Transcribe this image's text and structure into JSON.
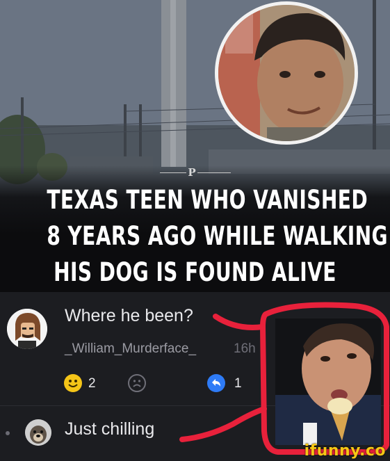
{
  "headline": {
    "logo": "P",
    "lines": [
      "TEXAS TEEN WHO VANISHED",
      "8 YEARS AGO WHILE WALKING",
      "HIS DOG IS FOUND ALIVE"
    ]
  },
  "comments": [
    {
      "text": "Where he been?",
      "username": "_William_Murderface_",
      "time": "16h",
      "reactions": [
        {
          "icon": "smile-icon",
          "count": "2"
        },
        {
          "icon": "frown-icon",
          "count": ""
        },
        {
          "icon": "reply-icon",
          "count": "1"
        }
      ]
    },
    {
      "text": "Just chilling"
    }
  ],
  "watermark": "ifunny.co",
  "colors": {
    "background": "#1c1d21",
    "annotation_red": "#e8213b",
    "smile_yellow": "#f5c518",
    "reply_blue": "#2e7bf6",
    "watermark_yellow": "#f6c715"
  }
}
